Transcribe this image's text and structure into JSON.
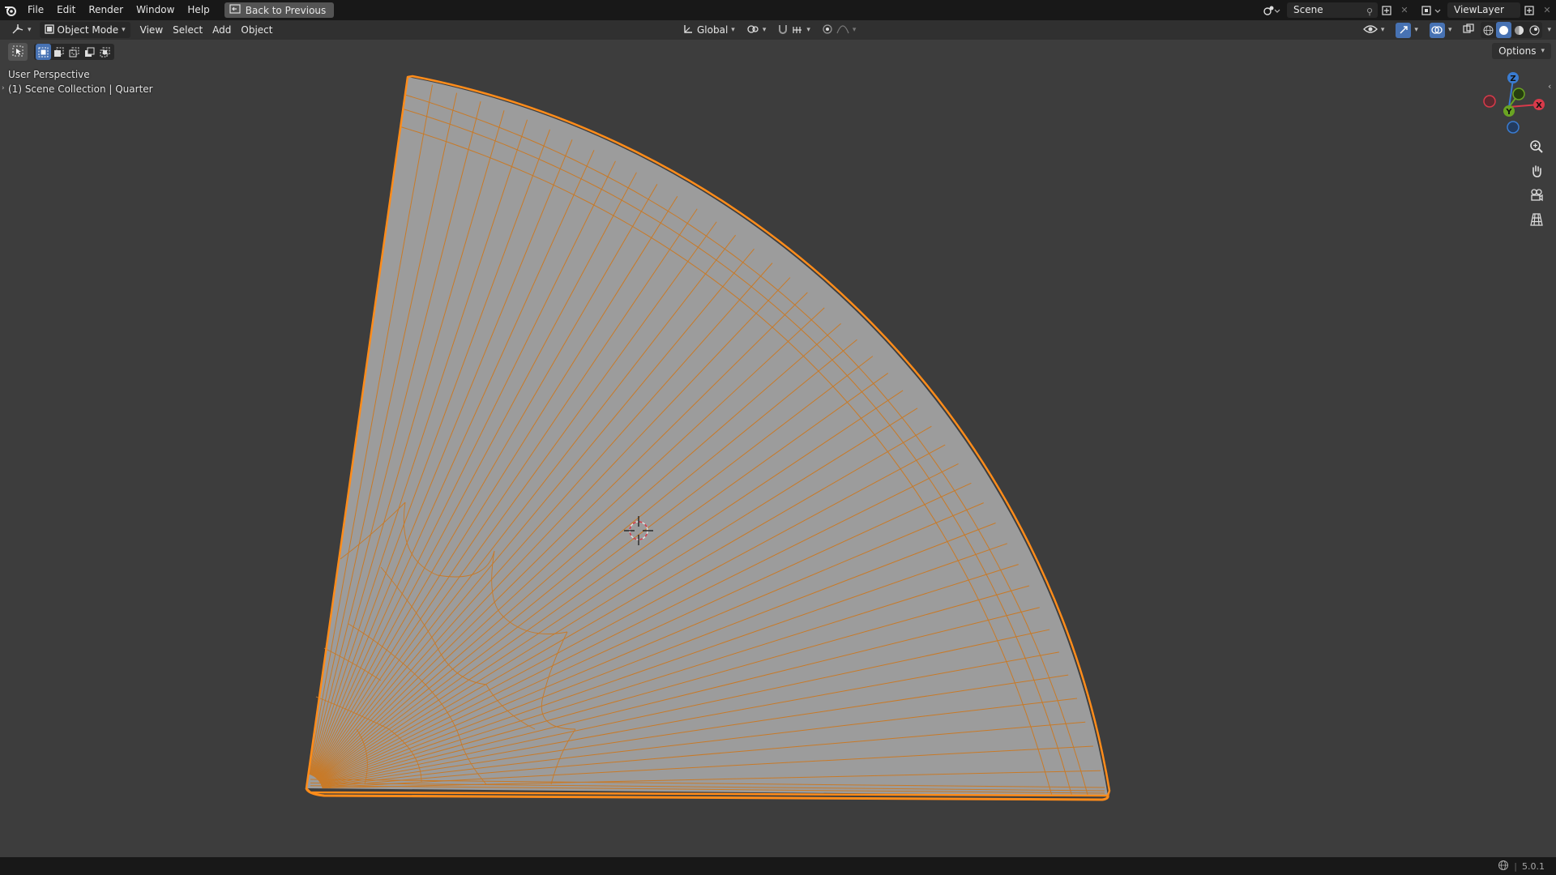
{
  "menubar": {
    "items": [
      "File",
      "Edit",
      "Render",
      "Window",
      "Help"
    ],
    "back_label": "Back to Previous"
  },
  "topright": {
    "scene_name": "Scene",
    "view_layer": "ViewLayer"
  },
  "header": {
    "mode": "Object Mode",
    "menus": [
      "View",
      "Select",
      "Add",
      "Object"
    ],
    "orientation": "Global"
  },
  "options_label": "Options",
  "viewport": {
    "title": "User Perspective",
    "collection": "(1) Scene Collection | Quarter"
  },
  "gizmo": {
    "x": "X",
    "y": "Y",
    "z": "Z"
  },
  "status": {
    "version": "5.0.1"
  },
  "colors": {
    "accent": "#4772b3",
    "selection_outline": "#ff8c1a",
    "wire": "#c87a28",
    "mesh_face": "#9c9c9c",
    "axis_x": "#d83a4a",
    "axis_y": "#6aa422",
    "axis_z": "#3a7cd1"
  }
}
